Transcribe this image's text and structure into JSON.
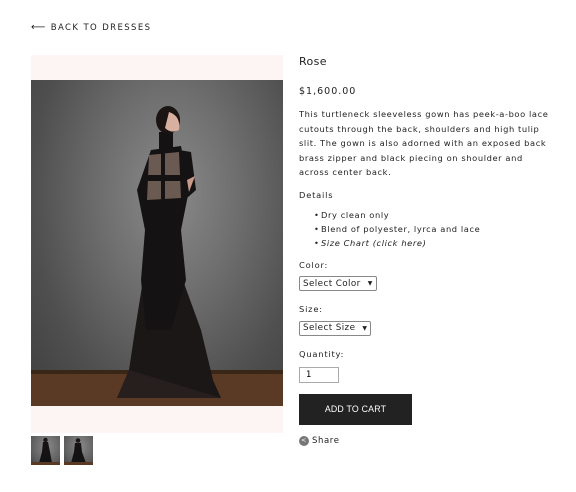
{
  "nav": {
    "back_arrow": "⟵",
    "back_label": "BACK TO DRESSES"
  },
  "product": {
    "title": "Rose",
    "price": "$1,600.00",
    "description": "This turtleneck sleeveless gown has peek-a-boo lace cutouts through the back, shoulders and high tulip slit. The gown is also adorned with an exposed back brass zipper and black piecing on shoulder and across center back.",
    "details_heading": "Details",
    "details": [
      "Dry clean only",
      "Blend of polyester, lyrca and lace"
    ],
    "size_chart_link": "Size Chart (click here)"
  },
  "options": {
    "color_label": "Color:",
    "color_value": "Select Color",
    "size_label": "Size:",
    "size_value": "Select Size",
    "quantity_label": "Quantity:",
    "quantity_value": "1"
  },
  "actions": {
    "add_to_cart": "ADD TO CART",
    "share": "Share"
  },
  "icons": {
    "back": "left-arrow-icon",
    "caret": "chevron-down-icon",
    "share": "share-icon"
  },
  "colors": {
    "button_bg": "#222222",
    "hero_bg": "#fdf4f4"
  },
  "thumbnails": [
    "thumbnail-1",
    "thumbnail-2"
  ]
}
